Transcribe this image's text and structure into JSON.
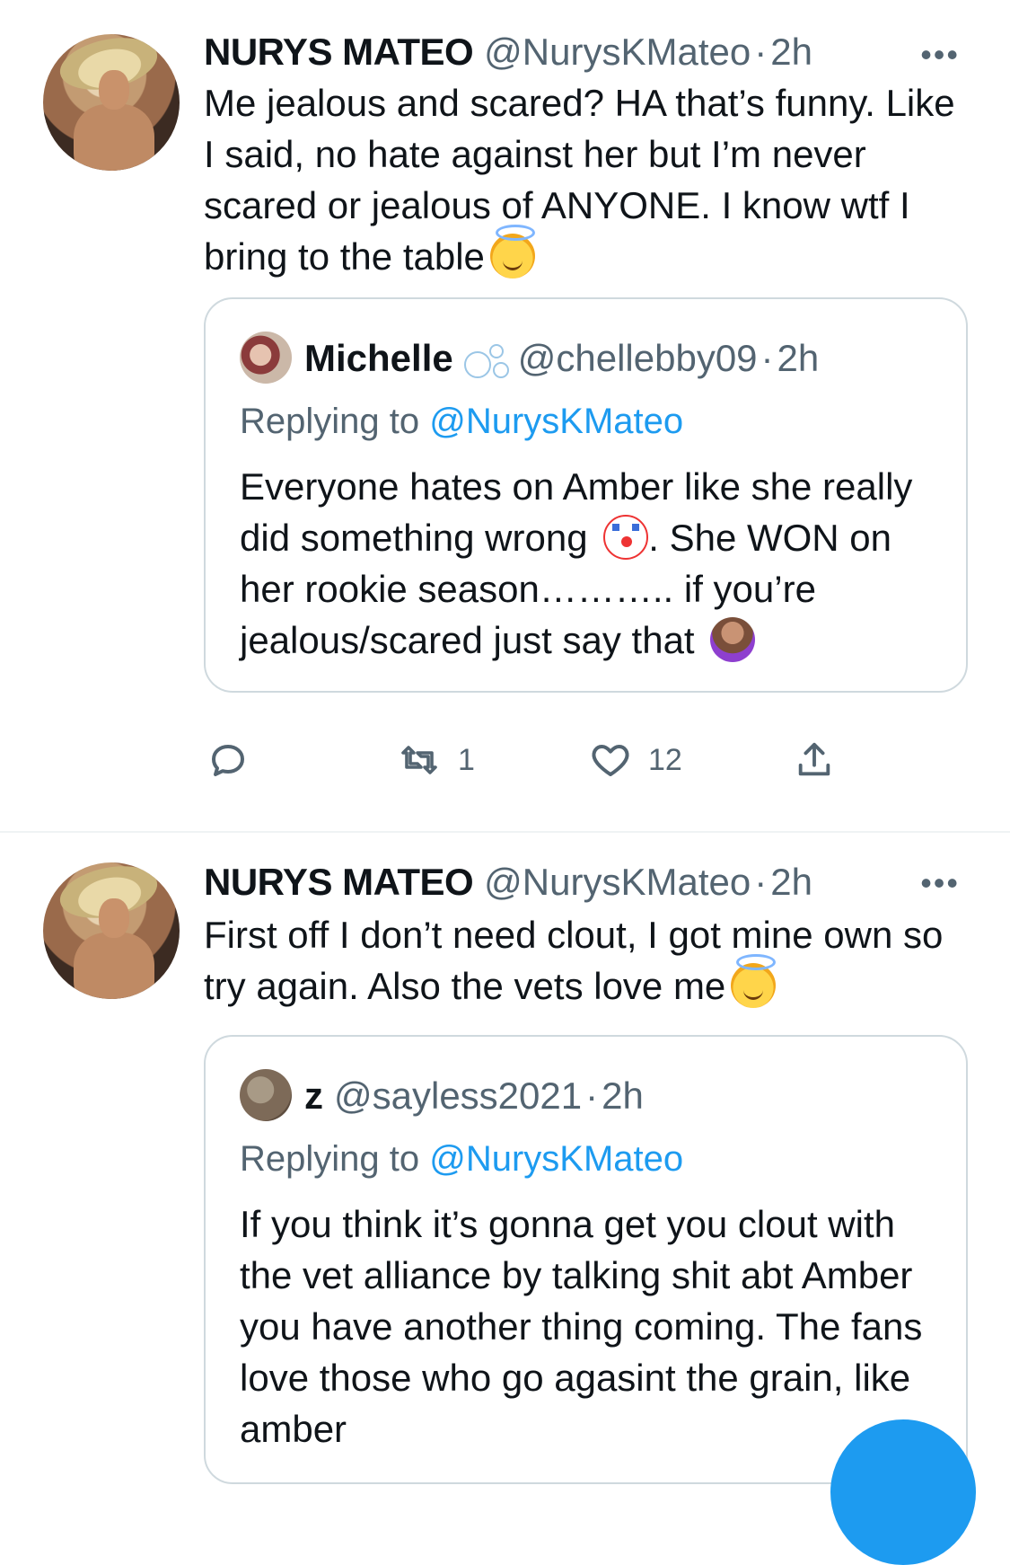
{
  "tweets": [
    {
      "author_name": "NURYS MATEO",
      "author_handle": "@NurysKMateo",
      "separator": "·",
      "time": "2h",
      "more": "•••",
      "text": "Me jealous and scared? HA that’s funny. Like I said, no hate against her but I’m never scared or jealous of ANYONE. I know wtf I bring to the table",
      "emoji": "smiling-face-with-halo",
      "quote": {
        "author_name": "Michelle",
        "author_handle": "@chellebby09",
        "separator": "·",
        "time": "2h",
        "replying_prefix": "Replying to ",
        "replying_to": "@NurysKMateo",
        "text_part1": "Everyone hates on Amber like she really did something wrong",
        "emoji1": "clown-face",
        "text_part2": ". She WON on her rookie season……….. if you’re jealous/scared just say that",
        "emoji2": "person-shrugging"
      },
      "actions": {
        "reply_icon": "reply-icon",
        "retweet_icon": "retweet-icon",
        "retweet_count": "1",
        "like_icon": "heart-icon",
        "like_count": "12",
        "share_icon": "share-icon"
      }
    },
    {
      "author_name": "NURYS MATEO",
      "author_handle": "@NurysKMateo",
      "separator": "·",
      "time": "2h",
      "more": "•••",
      "text": "First off I don’t need clout, I got mine own so try again. Also the vets love me",
      "emoji": "smiling-face-with-halo",
      "quote": {
        "author_name": "z",
        "author_handle": "@sayless2021",
        "separator": "·",
        "time": "2h",
        "replying_prefix": "Replying to ",
        "replying_to": "@NurysKMateo",
        "text": "If you think it’s gonna get you clout with the vet alliance by talking shit abt Amber you have another thing coming. The fans love those who go agasint the grain, like amber"
      }
    }
  ],
  "colors": {
    "text": "#0f1419",
    "secondary": "#536471",
    "accent": "#1d9bf0",
    "border": "#cfd9de"
  },
  "compose_fab_icon": "compose-icon"
}
